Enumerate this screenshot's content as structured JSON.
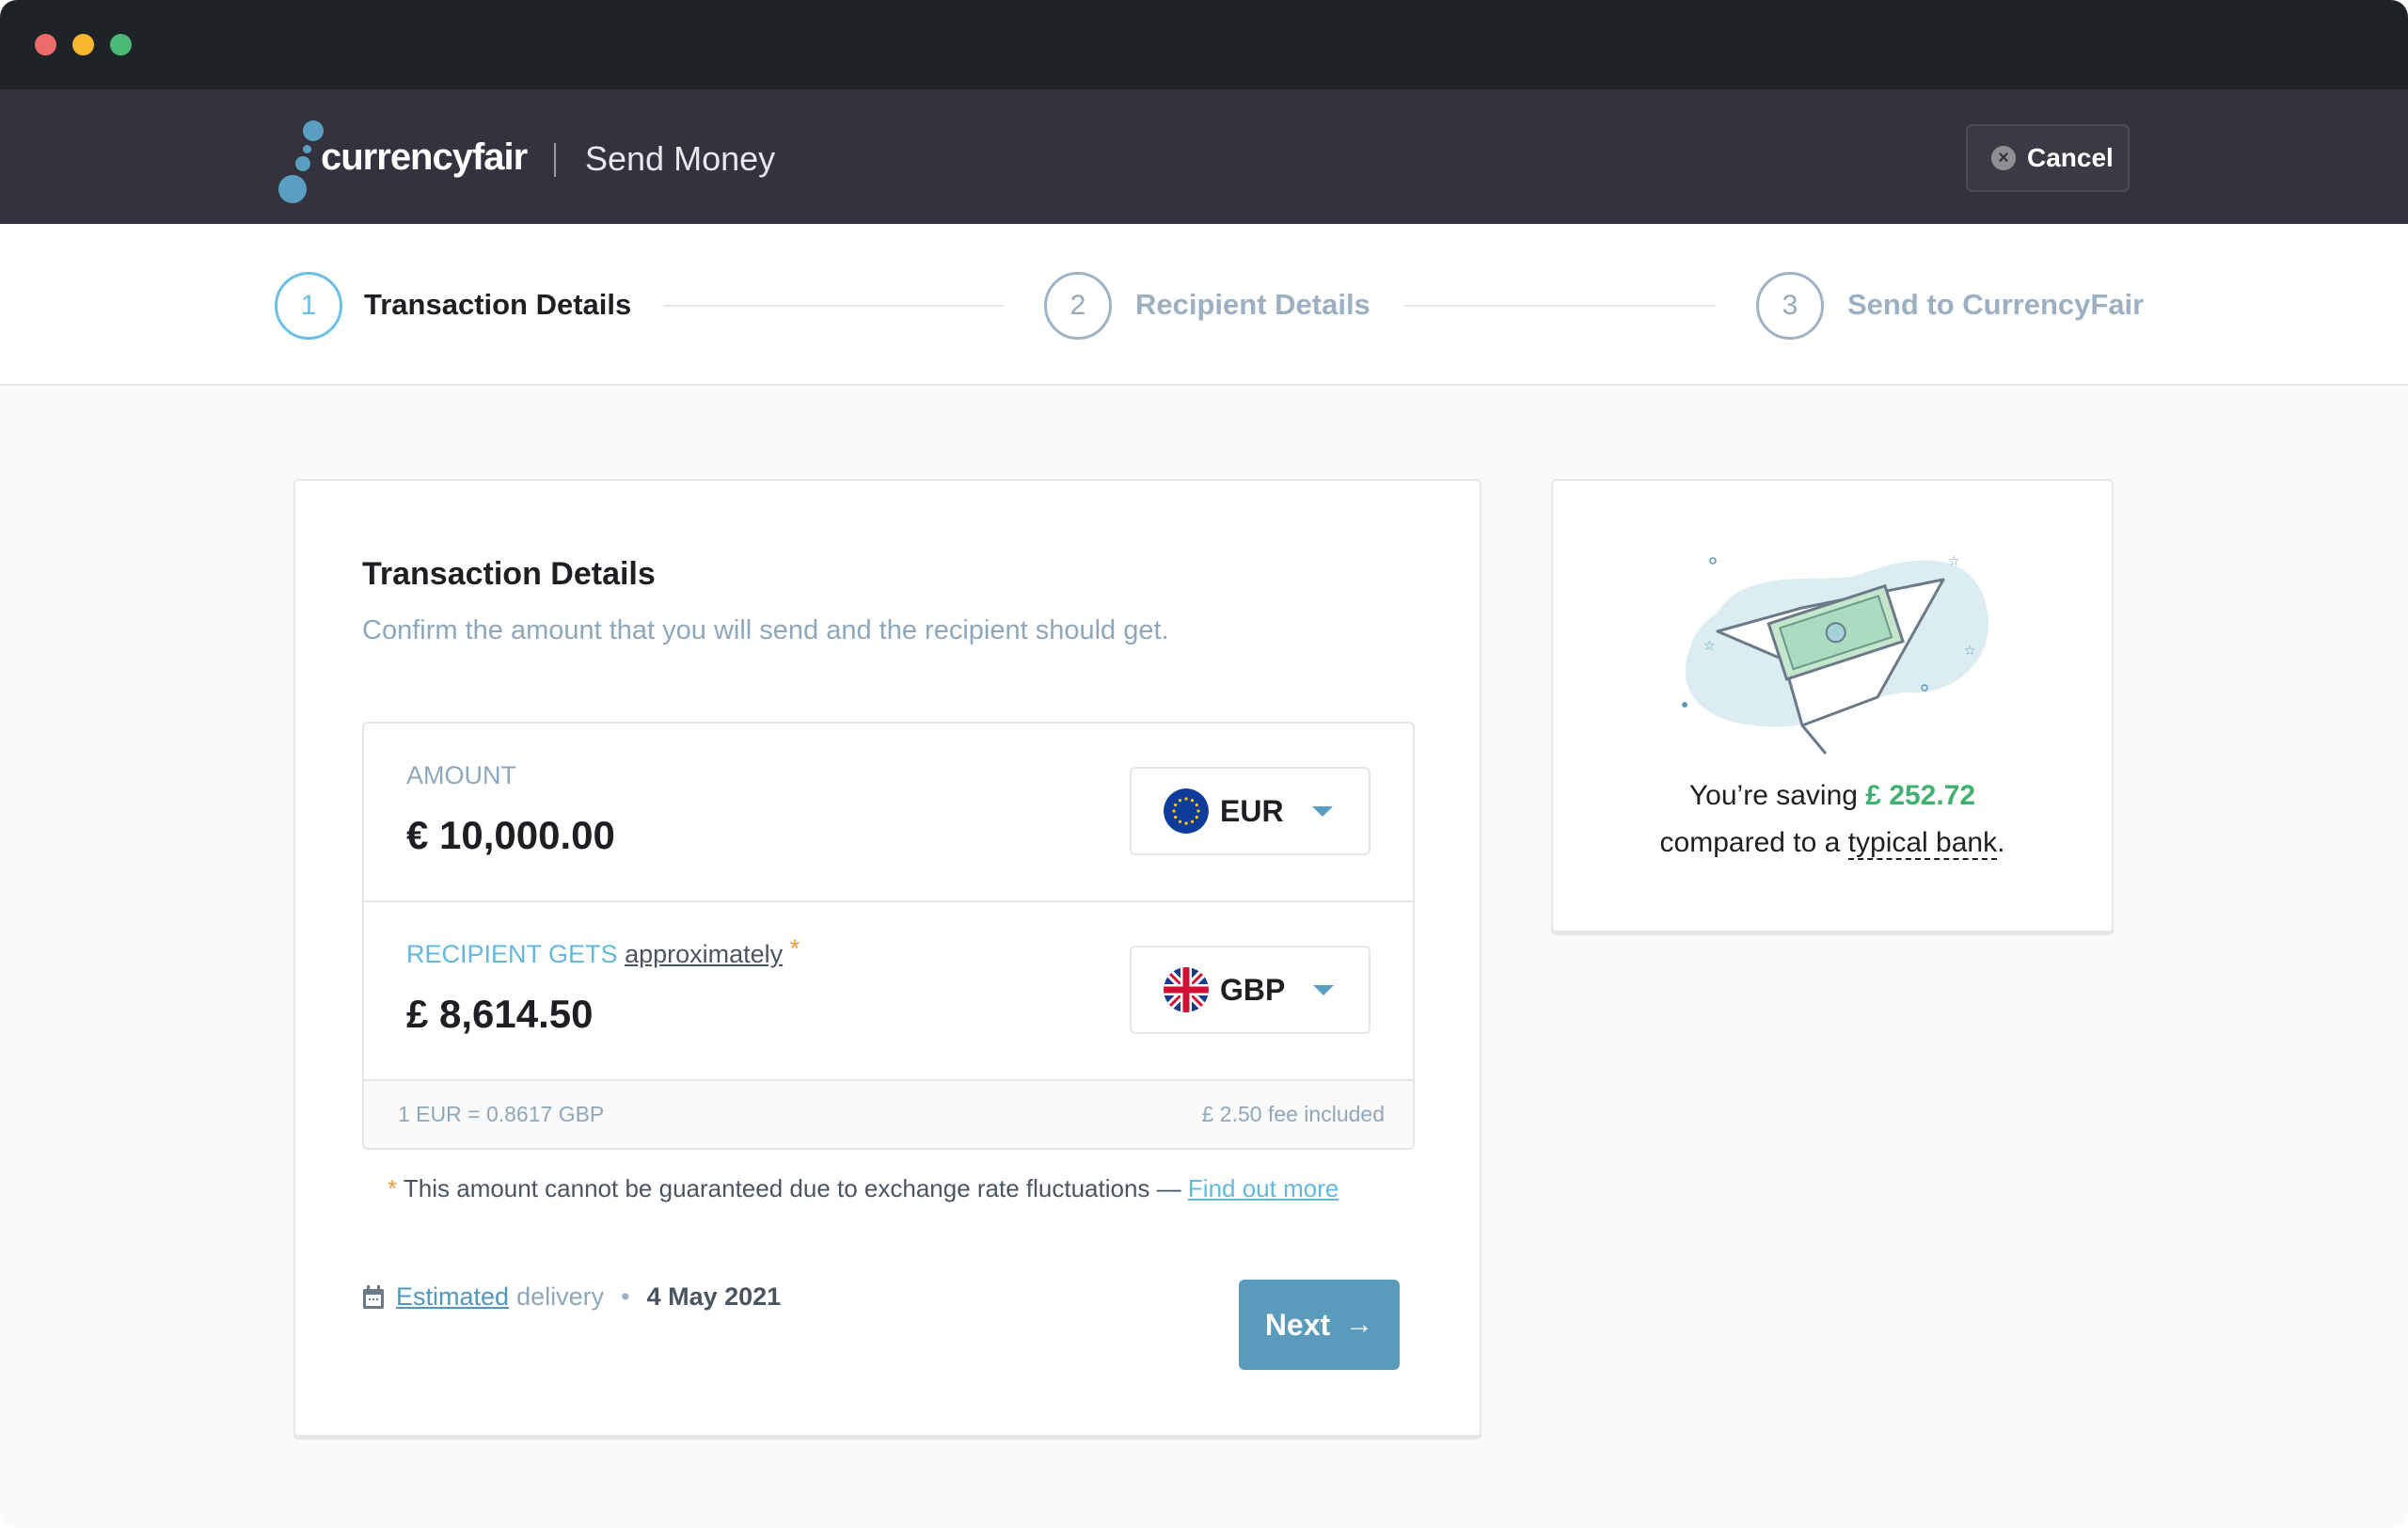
{
  "window": {
    "controls": [
      "close",
      "minimize",
      "maximize"
    ]
  },
  "header": {
    "brand": "currencyfair",
    "page_title": "Send Money",
    "cancel_label": "Cancel",
    "cancel_icon": "close-circle-icon"
  },
  "steps": [
    {
      "number": "1",
      "label": "Transaction Details",
      "active": true
    },
    {
      "number": "2",
      "label": "Recipient Details",
      "active": false
    },
    {
      "number": "3",
      "label": "Send to CurrencyFair",
      "active": false
    }
  ],
  "transaction": {
    "title": "Transaction Details",
    "subtitle": "Confirm the amount that you will send and the recipient should get.",
    "amount_label": "AMOUNT",
    "amount_value": "€ 10,000.00",
    "amount_currency": "EUR",
    "recipient_label": "RECIPIENT GETS",
    "recipient_approx": "approximately",
    "recipient_asterisk": "*",
    "recipient_value": "£ 8,614.50",
    "recipient_currency": "GBP",
    "rate": "1 EUR = 0.8617 GBP",
    "fee": "£ 2.50 fee included",
    "disclaimer_star": "*",
    "disclaimer": "This amount cannot be guaranteed due to exchange rate fluctuations —",
    "find_out_more": "Find out more",
    "estimated": "Estimated",
    "delivery": "delivery",
    "dot": "•",
    "delivery_date": "4 May 2021",
    "next_label": "Next",
    "next_arrow": "→"
  },
  "savings": {
    "prefix": "You’re saving",
    "amount": "£ 252.72",
    "line2_prefix": "compared to a",
    "typical_bank": "typical bank",
    "suffix": "."
  },
  "colors": {
    "accent": "#5a9bbb",
    "active_step": "#6cc0e8",
    "saving_green": "#3eb06f",
    "asterisk_orange": "#f09a3e"
  }
}
